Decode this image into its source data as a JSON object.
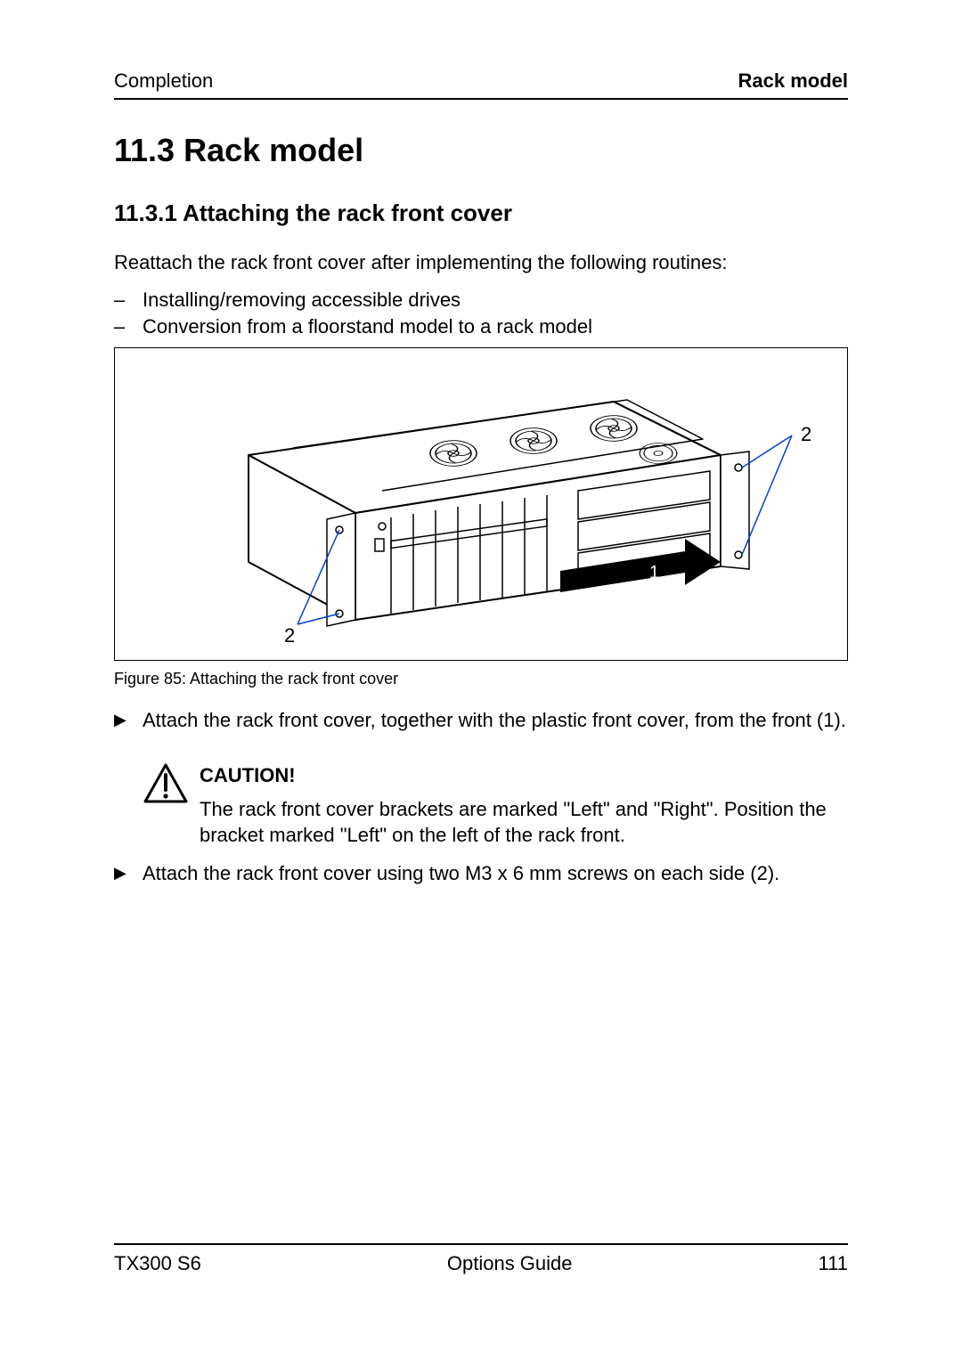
{
  "header": {
    "left": "Completion",
    "right": "Rack model"
  },
  "sections": {
    "h1": "11.3   Rack model",
    "h2": "11.3.1  Attaching the rack front cover",
    "intro": "Reattach the rack front cover after implementing the following routines:",
    "list": [
      "Installing/removing accessible drives",
      "Conversion from a floorstand model to a rack model"
    ],
    "caption": "Figure 85: Attaching the rack front cover",
    "step1": "Attach the rack front cover, together with the plastic front cover, from the front (1).",
    "caution_title": "CAUTION!",
    "caution_body": "The rack front cover brackets are marked \"Left\" and \"Right\". Position the bracket marked \"Left\" on the left of the rack front.",
    "step2": "Attach the rack front cover using two M3 x 6 mm screws on each side (2)."
  },
  "figure": {
    "labels": {
      "top_right": "2",
      "bottom_left": "2",
      "arrow": "1"
    }
  },
  "footer": {
    "left": "TX300 S6",
    "center": "Options Guide",
    "right": "111"
  }
}
